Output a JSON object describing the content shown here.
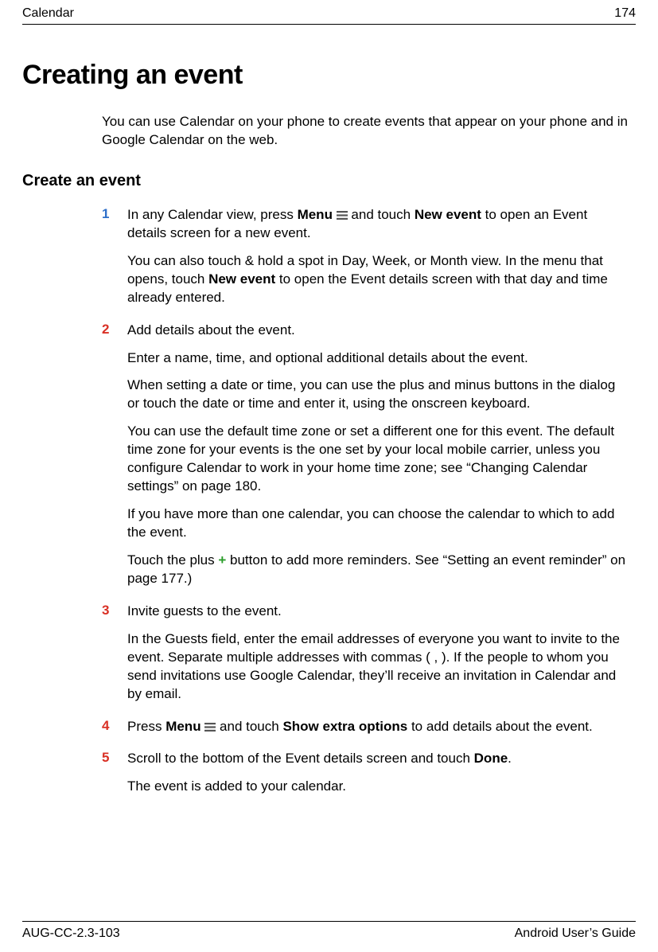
{
  "header": {
    "section": "Calendar",
    "page_number": "174"
  },
  "title": "Creating an event",
  "intro": "You can use Calendar on your phone to create events that appear on your phone and in Google Calendar on the web.",
  "subheading": "Create an event",
  "steps": {
    "s1": {
      "num": "1",
      "p1a": "In any Calendar view, press ",
      "p1b": "Menu",
      "p1c": " and touch ",
      "p1d": "New event",
      "p1e": " to open an Event details screen for a new event.",
      "p2a": "You can also touch & hold a spot in Day, Week, or Month view. In the menu that opens, touch ",
      "p2b": "New event",
      "p2c": " to open the Event details screen with that day and time already entered."
    },
    "s2": {
      "num": "2",
      "p1": "Add details about the event.",
      "p2": "Enter a name, time, and optional additional details about the event.",
      "p3": "When setting a date or time, you can use the plus and minus buttons in the dialog or touch the date or time and enter it, using the onscreen keyboard.",
      "p4": "You can use the default time zone or set a different one for this event. The default time zone for your events is the one set by your local mobile carrier, unless you configure Calendar to work in your home time zone; see “Changing Calendar settings” on page 180.",
      "p5": "If you have more than one calendar, you can choose the calendar to which to add the event.",
      "p6a": "Touch the plus ",
      "p6b": " button to add more reminders. See “Setting an event reminder” on page 177.)"
    },
    "s3": {
      "num": "3",
      "p1": "Invite guests to the event.",
      "p2": "In the Guests field, enter the email addresses of everyone you want to invite to the event. Separate multiple addresses with commas ( , ). If the people to whom you send invitations use Google Calendar, they’ll receive an invitation in Calendar and by email."
    },
    "s4": {
      "num": "4",
      "p1a": "Press ",
      "p1b": "Menu",
      "p1c": " and touch ",
      "p1d": "Show extra options",
      "p1e": " to add details about the event."
    },
    "s5": {
      "num": "5",
      "p1a": "Scroll to the bottom of the Event details screen and touch ",
      "p1b": "Done",
      "p1c": ".",
      "p2": "The event is added to your calendar."
    }
  },
  "footer": {
    "doc_id": "AUG-CC-2.3-103",
    "guide": "Android User’s Guide"
  }
}
